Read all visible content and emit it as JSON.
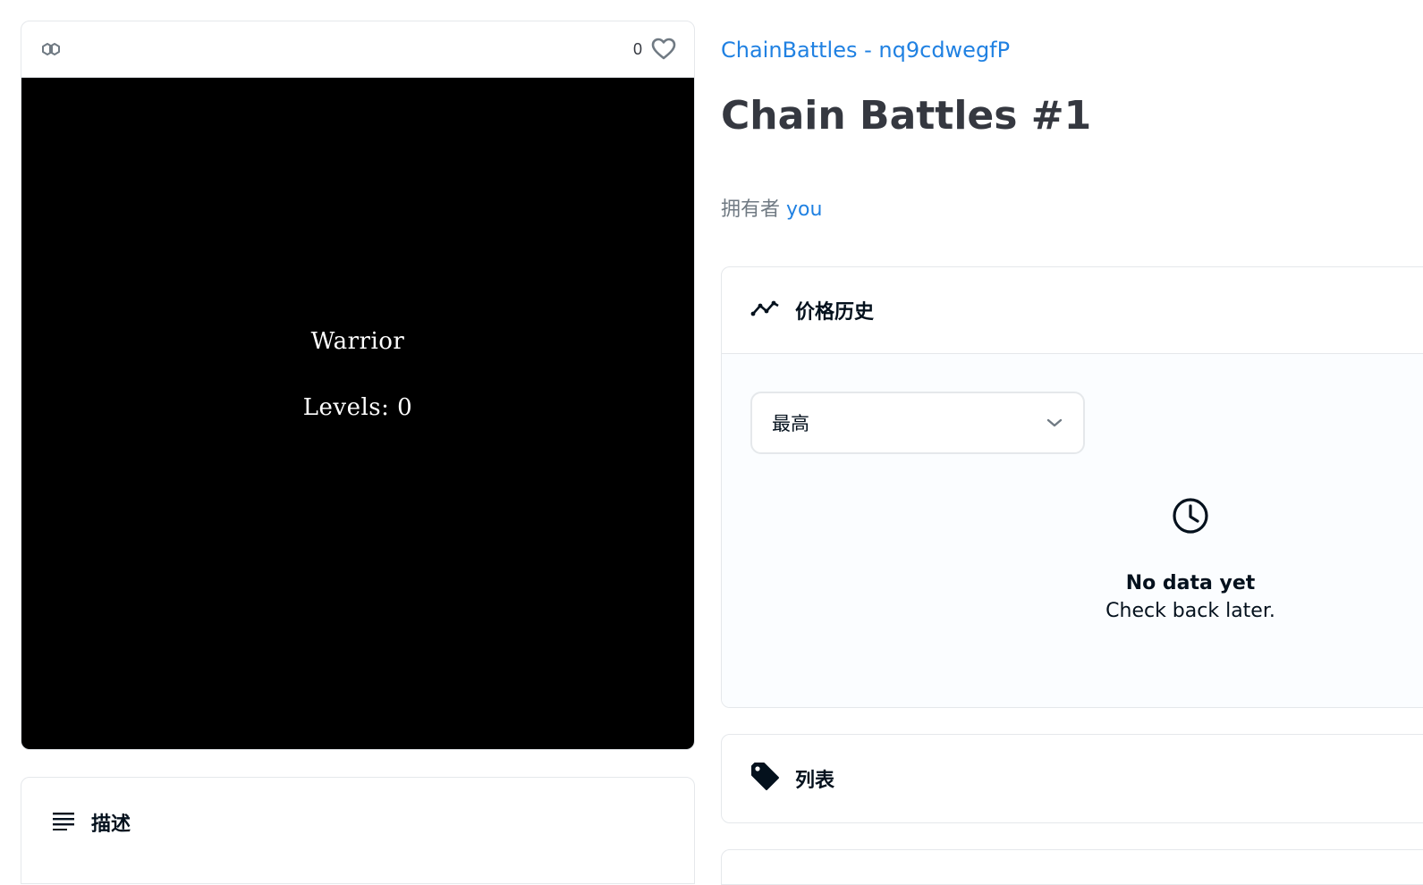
{
  "favorites": {
    "count": "0",
    "icon": "heart-outline-icon"
  },
  "chain": {
    "icon": "polygon-chain-icon"
  },
  "nft_image": {
    "line1": "Warrior",
    "line2": "Levels: 0",
    "background": "#000000"
  },
  "description": {
    "title": "描述",
    "icon": "list-lines-icon"
  },
  "item": {
    "collection": "ChainBattles - nq9cdwegfP",
    "title": "Chain Battles #1",
    "owner_prefix": "拥有者",
    "owner": "you"
  },
  "price_history": {
    "title": "价格历史",
    "icon": "trend-line-icon",
    "period_selected": "最高",
    "empty_title": "No data yet",
    "empty_subtitle": "Check back later."
  },
  "listings": {
    "title": "列表",
    "icon": "price-tag-icon"
  },
  "colors": {
    "link": "#2081e2",
    "title": "#353840",
    "muted": "#707a83",
    "border": "#e5e8eb"
  }
}
